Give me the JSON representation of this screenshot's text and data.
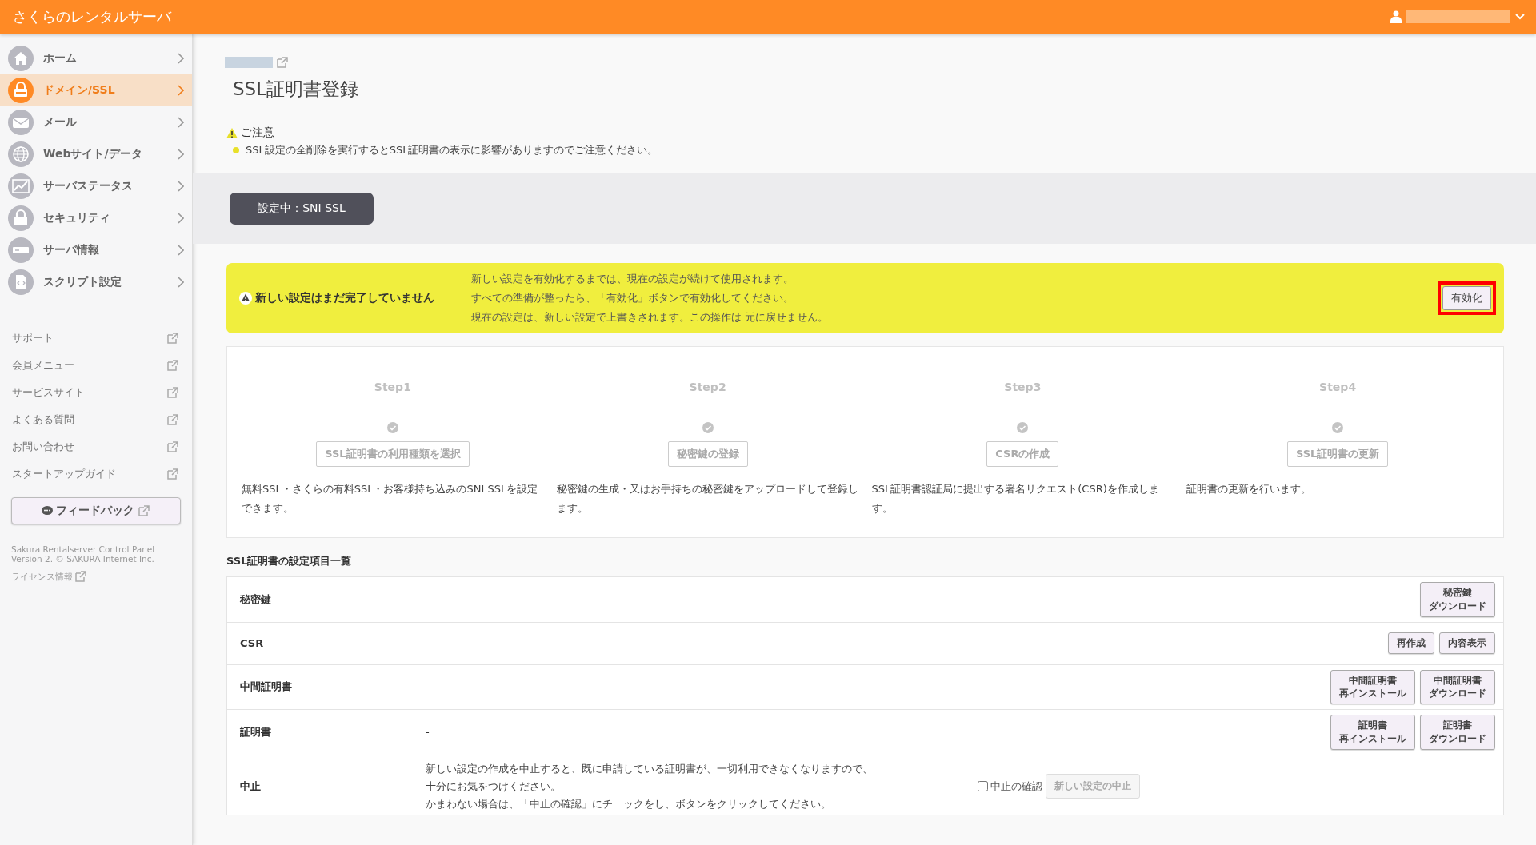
{
  "header": {
    "title": "さくらのレンタルサーバ"
  },
  "sidebar": {
    "items": [
      {
        "label": "ホーム",
        "selected": false
      },
      {
        "label": "ドメイン/SSL",
        "selected": true
      },
      {
        "label": "メール",
        "selected": false
      },
      {
        "label": "Webサイト/データ",
        "selected": false
      },
      {
        "label": "サーバステータス",
        "selected": false
      },
      {
        "label": "セキュリティ",
        "selected": false
      },
      {
        "label": "サーバ情報",
        "selected": false
      },
      {
        "label": "スクリプト設定",
        "selected": false
      }
    ],
    "links": [
      "サポート",
      "会員メニュー",
      "サービスサイト",
      "よくある質問",
      "お問い合わせ",
      "スタートアップガイド"
    ],
    "feedback": "フィードバック",
    "footer": "Sakura Rentalserver Control Panel Version 2. © SAKURA Internet Inc.",
    "license": "ライセンス情報"
  },
  "page": {
    "title": "SSL証明書登録",
    "notice_title": "ご注意",
    "notice": "SSL設定の全削除を実行するとSSL証明書の表示に影響がありますのでご注意ください。",
    "current": "設定中：SNI SSL"
  },
  "alert": {
    "title": "新しい設定はまだ完了していません",
    "lines": [
      "新しい設定を有効化するまでは、現在の設定が続けて使用されます。",
      "すべての準備が整ったら、「有効化」ボタンで有効化してください。",
      "現在の設定は、新しい設定で上書きされます。この操作は 元に戻せません。"
    ],
    "button": "有効化"
  },
  "steps": [
    {
      "label": "Step1",
      "button": "SSL証明書の利用種類を選択",
      "desc": "無料SSL・さくらの有料SSL・お客様持ち込みのSNI SSLを設定できます。"
    },
    {
      "label": "Step2",
      "button": "秘密鍵の登録",
      "desc": "秘密鍵の生成・又はお手持ちの秘密鍵をアップロードして登録します。"
    },
    {
      "label": "Step3",
      "button": "CSRの作成",
      "desc": "SSL証明書認証局に提出する署名リクエスト(CSR)を作成します。"
    },
    {
      "label": "Step4",
      "button": "SSL証明書の更新",
      "desc": "証明書の更新を行います。"
    }
  ],
  "settings": {
    "title": "SSL証明書の設定項目一覧",
    "rows": [
      {
        "name": "秘密鍵",
        "value": "-",
        "buttons": [
          [
            "秘密鍵",
            "ダウンロード"
          ]
        ]
      },
      {
        "name": "CSR",
        "value": "-",
        "buttons": [
          [
            "再作成"
          ],
          [
            "内容表示"
          ]
        ]
      },
      {
        "name": "中間証明書",
        "value": "-",
        "buttons": [
          [
            "中間証明書",
            "再インストール"
          ],
          [
            "中間証明書",
            "ダウンロード"
          ]
        ]
      },
      {
        "name": "証明書",
        "value": "-",
        "buttons": [
          [
            "証明書",
            "再インストール"
          ],
          [
            "証明書",
            "ダウンロード"
          ]
        ]
      }
    ],
    "cancel": {
      "name": "中止",
      "lines": [
        "新しい設定の作成を中止すると、既に申請している証明書が、一切利用できなくなりますので、",
        "十分にお気をつけください。",
        "かまわない場合は、「中止の確認」にチェックをし、ボタンをクリックしてください。"
      ],
      "confirm": "中止の確認",
      "checked": false,
      "button": "新しい設定の中止",
      "disabled": true
    }
  }
}
